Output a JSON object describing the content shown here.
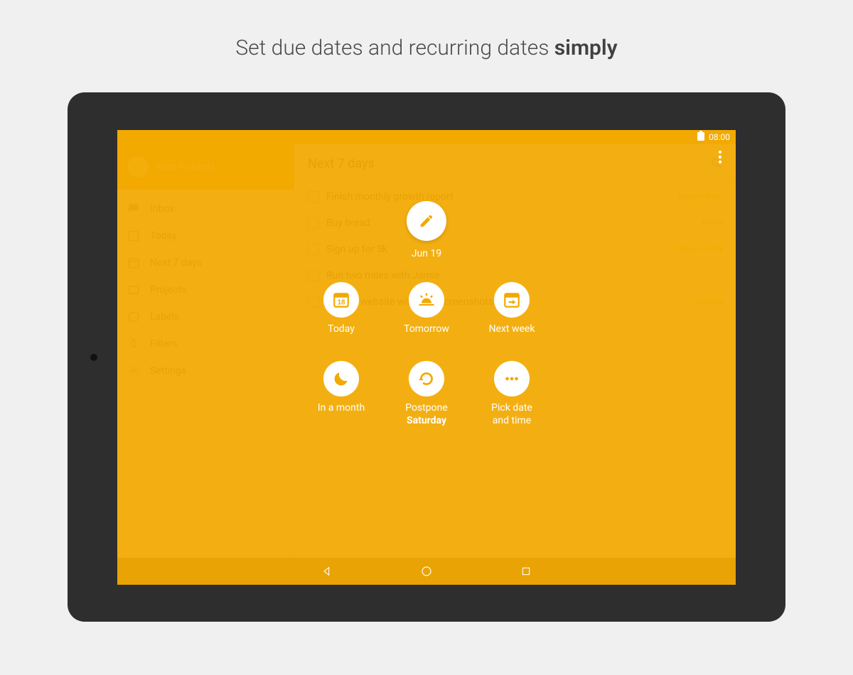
{
  "marketing": {
    "title_prefix": "Set due dates and recurring dates ",
    "title_bold": "simply"
  },
  "status_bar": {
    "time": "08:00"
  },
  "sidebar": {
    "user_name": "Allan Richards",
    "items": [
      {
        "label": "Inbox"
      },
      {
        "label": "Today"
      },
      {
        "label": "Next 7 days"
      },
      {
        "label": "Projects"
      },
      {
        "label": "Labels"
      },
      {
        "label": "Filters"
      },
      {
        "label": "Settings"
      }
    ]
  },
  "main": {
    "header_title": "Next 7 days",
    "tasks": [
      {
        "label": "Finish monthly growth report",
        "meta": "Growth team"
      },
      {
        "label": "Buy bread",
        "meta": "Home"
      },
      {
        "label": "Sign up for 5k",
        "meta": "Things To Try"
      },
      {
        "label": "Run two miles with Jamie",
        "meta": ""
      },
      {
        "label": "Update website with new screenshots",
        "meta": "Website"
      }
    ]
  },
  "date_picker": {
    "current_label": "Jun 19",
    "today_number": "18",
    "options": {
      "today": "Today",
      "tomorrow": "Tomorrow",
      "next_week": "Next week",
      "in_a_month": "In a month",
      "postpone_line1": "Postpone",
      "postpone_line2": "Saturday",
      "pick_line1": "Pick date",
      "pick_line2": "and time"
    }
  }
}
